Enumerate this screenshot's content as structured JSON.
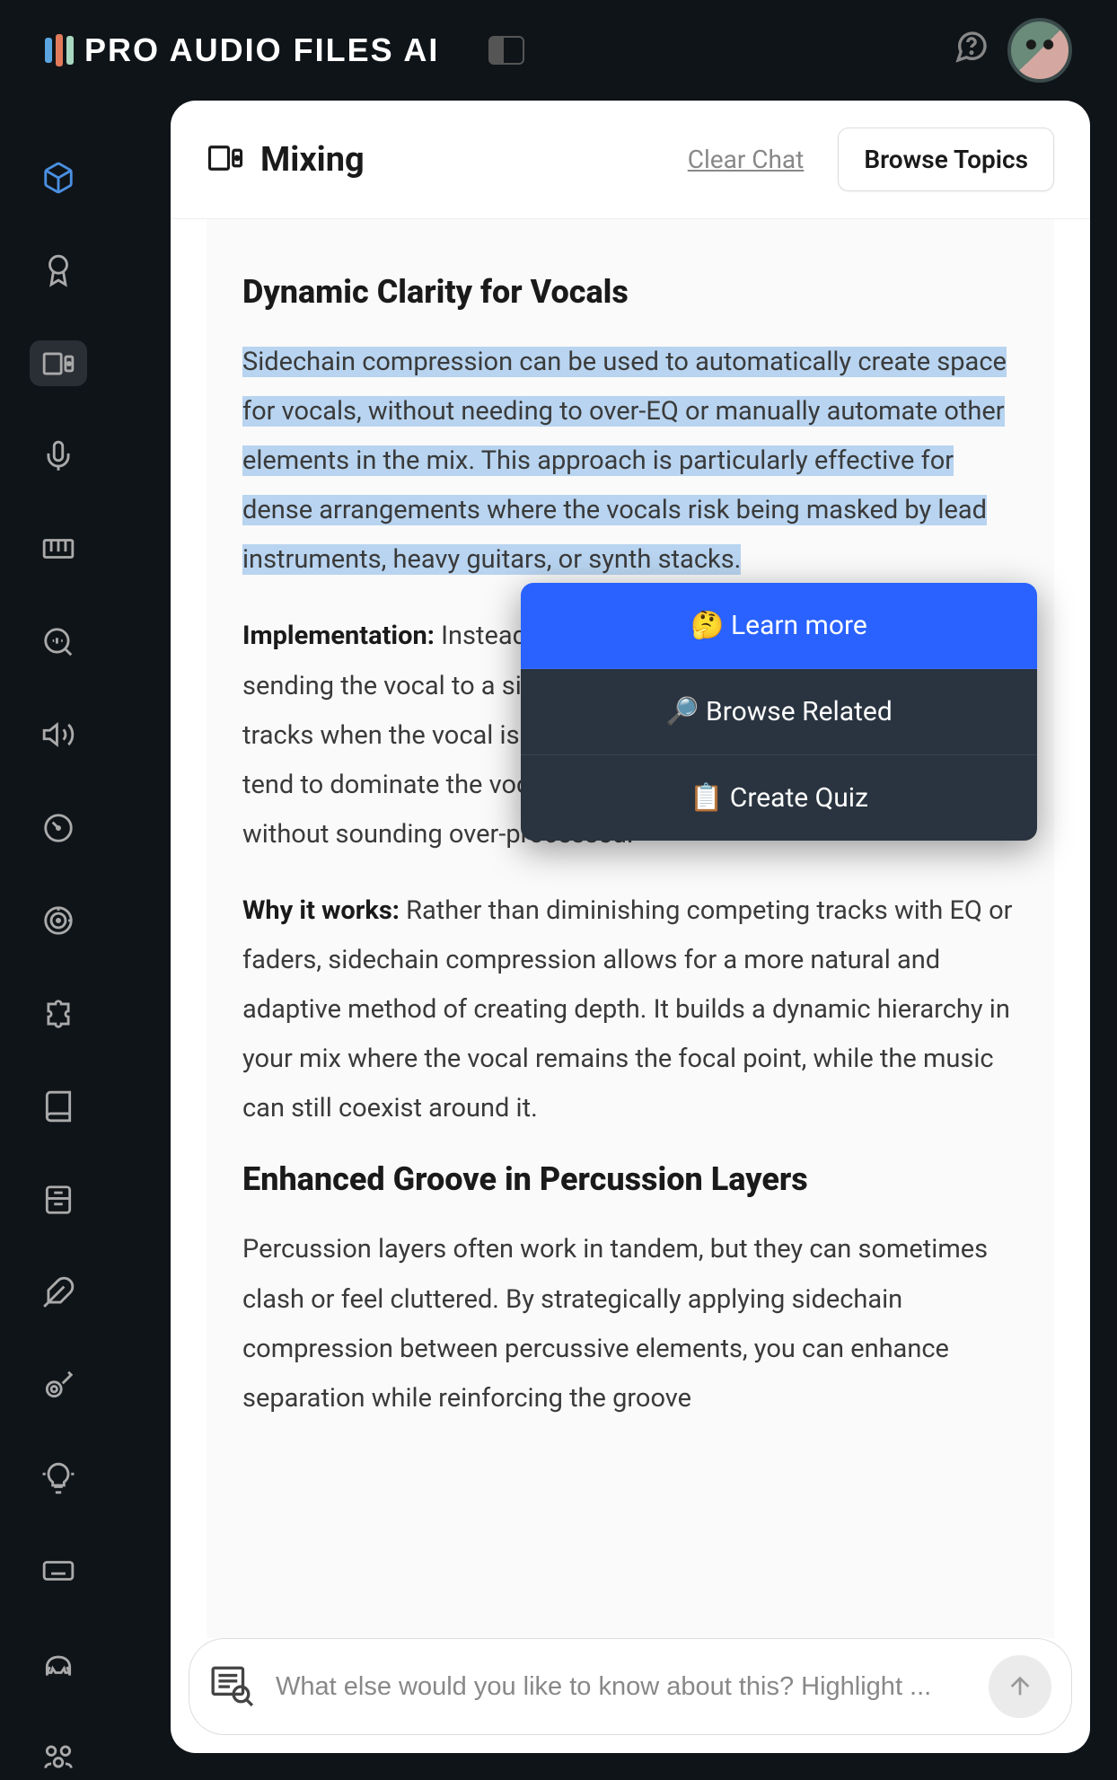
{
  "header": {
    "brand": "PRO AUDIO FILES AI"
  },
  "card": {
    "title": "Mixing",
    "clear_label": "Clear Chat",
    "browse_label": "Browse Topics"
  },
  "article": {
    "h1": "Dynamic Clarity for Vocals",
    "p1": "Sidechain compression can be used to automatically create space for vocals, without needing to over-EQ or manually automate other elements in the mix. This approach is particularly effective for dense arrangements where the vocals risk being masked by lead instruments, heavy guitars, or synth stacks.",
    "impl_label": "Implementation:",
    "impl_text": " Instead of tying compression to a kick, try sending the vocal to a sidechain input to compress instrument tracks when the vocal is active. Key parts like guitars and keys that tend to dominate the vocal but should step back to let it shine—without sounding over-processed.",
    "why_label": "Why it works:",
    "why_text": " Rather than diminishing competing tracks with EQ or faders, sidechain compression allows for a more natural and adaptive method of creating depth. It builds a dynamic hierarchy in your mix where the vocal remains the focal point, while the music can still coexist around it.",
    "h2": "Enhanced Groove in Percussion Layers",
    "p2": "Percussion layers often work in tandem, but they can sometimes clash or feel cluttered. By strategically applying sidechain compression between percussive elements, you can enhance separation while reinforcing the groove"
  },
  "context_menu": {
    "learn": "🤔 Learn more",
    "related": "🔎 Browse Related",
    "quiz": "📋 Create Quiz"
  },
  "input": {
    "placeholder": "What else would you like to know about this? Highlight ..."
  }
}
